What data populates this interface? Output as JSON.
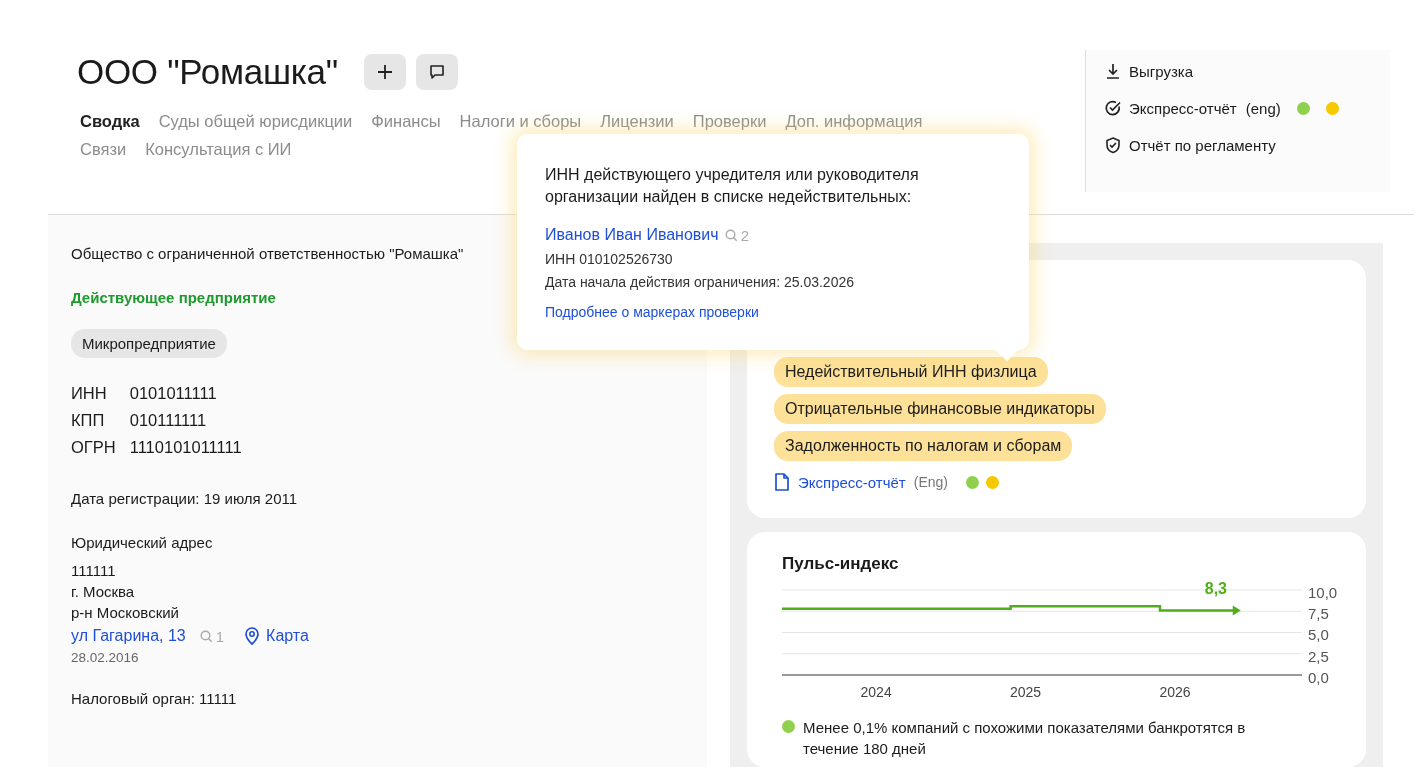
{
  "header": {
    "title": "ООО \"Ромашка\"",
    "actions": [
      {
        "kind": "add"
      },
      {
        "kind": "comment"
      }
    ]
  },
  "tabs": [
    {
      "label": "Сводка",
      "selected": true
    },
    {
      "label": "Суды общей юрисдикции",
      "selected": false
    },
    {
      "label": "Финансы",
      "selected": false
    },
    {
      "label": "Налоги и сборы",
      "selected": false
    },
    {
      "label": "Лицензии",
      "selected": false
    },
    {
      "label": "Проверки",
      "selected": false
    },
    {
      "label": "Доп. информация",
      "selected": false
    },
    {
      "label": "Связи",
      "selected": false
    },
    {
      "label": "Консультация с ИИ",
      "selected": false
    }
  ],
  "side_menu": [
    {
      "kind": "download",
      "label": "Выгрузка"
    },
    {
      "kind": "check",
      "label": "Экспресс-отчёт",
      "suffix": "(eng)",
      "dots": [
        {
          "color": "#8fd14f"
        },
        {
          "color": "#f5c800"
        }
      ]
    },
    {
      "kind": "shield",
      "label": "Отчёт по регламенту"
    }
  ],
  "company": {
    "full_name": "Общество с ограниченной ответственностью \"Ромашка\"",
    "status": "Действующее предприятие",
    "category": "Микропредприятие",
    "codes": [
      {
        "label": "ИНН",
        "value": "0101011111"
      },
      {
        "label": "КПП",
        "value": "010111111"
      },
      {
        "label": "ОГРН",
        "value": "1110101011111"
      }
    ],
    "registration": "Дата регистрации: 19 июля 2011",
    "address_title": "Юридический адрес",
    "address_lines": [
      "111111",
      "г. Москва",
      "р-н Московский"
    ],
    "street": "ул Гагарина, 13",
    "street_count": "1",
    "map_link": "Карта",
    "address_date": "28.02.2016",
    "tax_office": "Налоговый орган: 11111"
  },
  "tooltip": {
    "message": "ИНН действующего учредителя или руководителя организации найден в списке недействительных:",
    "person": "Иванов Иван Иванович",
    "person_count": "2",
    "inn": "ИНН 010102526730",
    "restriction": "Дата начала действия ограничения: 25.03.2026",
    "link": "Подробнее о маркерах проверки"
  },
  "markers": {
    "tags": [
      "Недействительный ИНН физлица",
      "Отрицательные финансовые индикаторы",
      "Задолженность по налогам и сборам"
    ],
    "report_link": "Экспресс-отчёт",
    "report_suffix": "(Eng)",
    "dots": [
      {
        "color": "#8fd14f"
      },
      {
        "color": "#f5c800"
      }
    ]
  },
  "pulse": {
    "title": "Пульс-индекс",
    "value_label": "8,3",
    "chart_data": {
      "type": "line",
      "x": [
        2023.37,
        2024.9,
        2024.9,
        2025.9,
        2025.9,
        2026.4
      ],
      "grid": true,
      "series": [
        {
          "color": "#52ad1c",
          "values": [
            7.8,
            7.8,
            8.1,
            8.1,
            7.6,
            7.6
          ]
        }
      ],
      "xlim": [
        2023.37,
        2026.85
      ],
      "ylim": [
        0,
        10
      ],
      "xticks": [
        2024,
        2025,
        2026
      ],
      "yticks": [
        {
          "value": 0,
          "label": "0,0"
        },
        {
          "value": 2.5,
          "label": "2,5"
        },
        {
          "value": 5,
          "label": "5,0"
        },
        {
          "value": 7.5,
          "label": "7,5"
        },
        {
          "value": 10,
          "label": "10,0"
        }
      ]
    },
    "legend": [
      {
        "text": "Менее 0,1% компаний с похожими показателями банкротятся в течение 180 дней",
        "color": "#8fd14f"
      }
    ]
  }
}
